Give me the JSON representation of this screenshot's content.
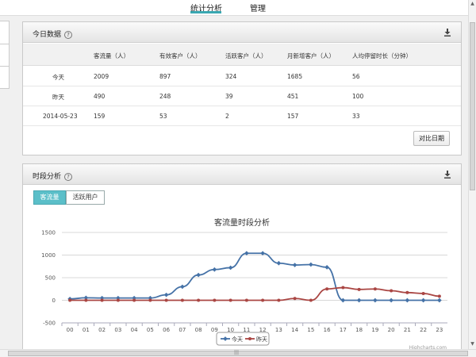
{
  "nav": {
    "tabs": [
      {
        "label": "统计分析",
        "active": true
      },
      {
        "label": "管理",
        "active": false
      }
    ]
  },
  "today_panel": {
    "title": "今日数据",
    "help_icon": "question-circle-icon",
    "download_icon": "download-icon",
    "columns": [
      "",
      "客流量（人）",
      "有效客户（人）",
      "活跃客户（人）",
      "月新增客户（人）",
      "人均停留时长（分钟）"
    ],
    "rows": [
      [
        "今天",
        "2009",
        "897",
        "324",
        "1685",
        "56"
      ],
      [
        "昨天",
        "490",
        "248",
        "39",
        "451",
        "100"
      ],
      [
        "2014-05-23",
        "159",
        "53",
        "2",
        "157",
        "33"
      ]
    ],
    "compare_button": "对比日期"
  },
  "period_panel": {
    "title": "时段分析",
    "help_icon": "question-circle-icon",
    "download_icon": "download-icon",
    "toggles": [
      "客流量",
      "活跃用户"
    ],
    "credit": "Highcharts.com"
  },
  "colors": {
    "today": "#4572a7",
    "yesterday": "#aa4643",
    "accent": "#3aa8b2"
  },
  "chart_data": {
    "type": "line",
    "title": "客流量时段分析",
    "categories": [
      "00",
      "01",
      "02",
      "03",
      "04",
      "05",
      "06",
      "07",
      "08",
      "09",
      "10",
      "11",
      "12",
      "13",
      "14",
      "15",
      "16",
      "17",
      "18",
      "19",
      "20",
      "21",
      "22",
      "23"
    ],
    "ylim": [
      -500,
      1500
    ],
    "yticks": [
      -500,
      0,
      500,
      1000,
      1500
    ],
    "series": [
      {
        "name": "今天",
        "values": [
          30,
          55,
          50,
          50,
          50,
          50,
          120,
          300,
          560,
          680,
          720,
          1040,
          1040,
          820,
          780,
          790,
          730,
          0,
          0,
          0,
          0,
          0,
          0,
          0
        ]
      },
      {
        "name": "昨天",
        "values": [
          0,
          0,
          0,
          0,
          0,
          0,
          0,
          0,
          0,
          0,
          0,
          0,
          0,
          0,
          40,
          0,
          250,
          280,
          240,
          250,
          210,
          170,
          150,
          90
        ]
      }
    ],
    "legend": "bottom-center",
    "grid": true
  }
}
